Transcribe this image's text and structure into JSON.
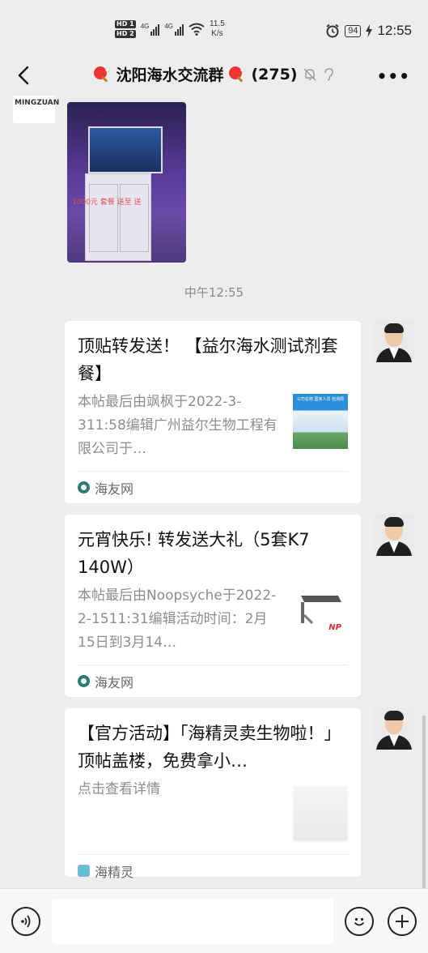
{
  "status_bar": {
    "hd1": "HD 1",
    "hd2": "HD 2",
    "net1": "4G",
    "net2": "4G",
    "speed_value": "11.5",
    "speed_unit": "K/s",
    "battery": "94",
    "time": "12:55"
  },
  "header": {
    "title": "沈阳海水交流群",
    "member_count": "(275)",
    "more": "•••"
  },
  "chat": {
    "first_sender_logo": "MINGZUAN",
    "image_message_caption": "1000元 套餐 送至 送",
    "timestamp": "中午12:55",
    "messages": [
      {
        "title": "顶贴转发送！ 【益尔海水测试剂套餐】",
        "description": "本帖最后由飒枫于2022-3-311:58编辑广州益尔生物工程有限公司于…",
        "source": "海友网",
        "thumb_caption": "公司名称 国家人员 检测局"
      },
      {
        "title": "元宵快乐! 转发送大礼（5套K7 140W）",
        "description": "本帖最后由Noopsyche于2022-2-1511:31编辑活动时间：2月15日到3月14…",
        "source": "海友网",
        "thumb_caption": "NP"
      },
      {
        "title": "【官方活动】「海精灵卖生物啦！」顶帖盖楼，免费拿小…",
        "description": "点击查看详情",
        "source": "海精灵"
      }
    ]
  },
  "colors": {
    "background": "#ededed",
    "card": "#ffffff",
    "muted_text": "#8d8d8d"
  }
}
